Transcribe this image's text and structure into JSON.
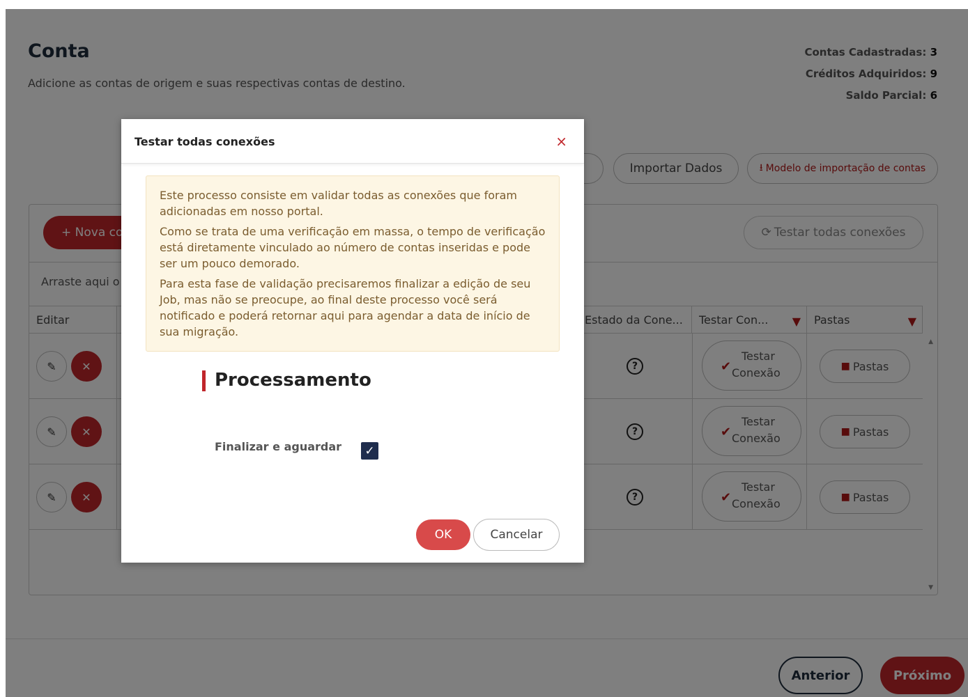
{
  "page": {
    "title": "Conta",
    "subtitle": "Adicione as contas de origem e suas respectivas contas de destino."
  },
  "stats": [
    {
      "label": "Contas Cadastradas:",
      "value": "3"
    },
    {
      "label": "Créditos Adquiridos:",
      "value": "9"
    },
    {
      "label": "Saldo Parcial:",
      "value": "6"
    }
  ],
  "actions": {
    "import_label": "Importar Dados",
    "model_label": "Modelo de importação de contas"
  },
  "grid": {
    "nova_label": "+ Nova co",
    "test_all_label": "Testar todas conexões",
    "drag_text": "Arraste aqui o",
    "headers": {
      "editar": "Editar",
      "estado": "Estado da Cone...",
      "testar": "Testar Con...",
      "pastas": "Pastas"
    },
    "rows": [
      {
        "testar_line1": "Testar",
        "testar_line2": "Conexão",
        "pastas": "Pastas"
      },
      {
        "testar_line1": "Testar",
        "testar_line2": "Conexão",
        "pastas": "Pastas"
      },
      {
        "testar_line1": "Testar",
        "testar_line2": "Conexão",
        "pastas": "Pastas"
      }
    ]
  },
  "footer": {
    "anterior": "Anterior",
    "proximo": "Próximo"
  },
  "modal": {
    "title": "Testar todas conexões",
    "close_icon": "×",
    "alert": [
      "Este processo consiste em validar todas as conexões que foram adicionadas em nosso portal.",
      "Como se trata de uma verificação em massa, o tempo de verificação está diretamente vinculado ao número de contas inseridas e pode ser um pouco demorado.",
      "Para esta fase de validação precisaremos finalizar a edição de seu Job, mas não se preocupe, ao final deste processo você será notificado e poderá retornar aqui para agendar a data de início de sua migração."
    ],
    "section_title": "Processamento",
    "checkbox_label": "Finalizar e aguardar",
    "checkbox_checked": true,
    "ok_label": "OK",
    "cancel_label": "Cancelar"
  },
  "colors": {
    "brand_red": "#c0262b",
    "navy": "#1f2d3d",
    "alert_bg": "#fdf6e4"
  }
}
